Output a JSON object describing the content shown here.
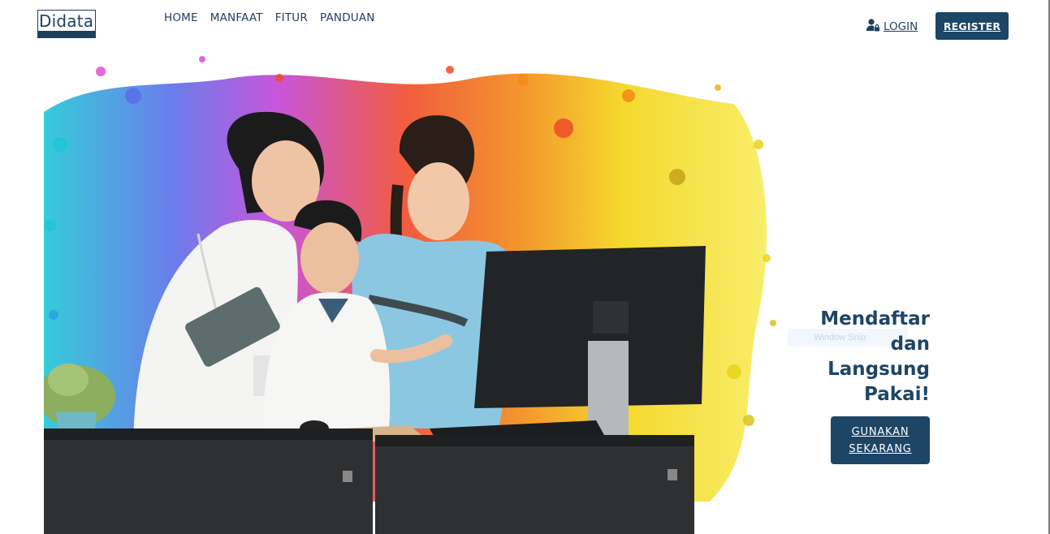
{
  "header": {
    "logo_text": "Didata",
    "nav": [
      "HOME",
      "MANFAAT",
      "FITUR",
      "PANDUAN"
    ],
    "login_label": "LOGIN",
    "register_label": "REGISTER"
  },
  "hero": {
    "image_icon": "medical-team-computer-illustration",
    "headline_lines": [
      "Mendaftar",
      "dan",
      "Langsung",
      "Pakai!"
    ],
    "overlay_label": "Window Snip",
    "cta_lines": [
      "GUNAKAN",
      "SEKARANG"
    ]
  },
  "colors": {
    "brand": "#1d4566",
    "text": "#1f3f5f",
    "background": "#ffffff"
  }
}
